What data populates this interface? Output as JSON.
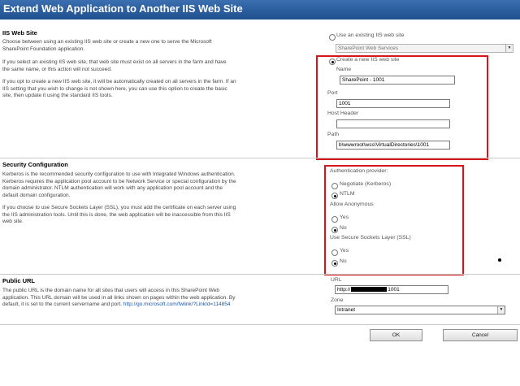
{
  "window": {
    "title": "Extend Web Application to Another IIS Web Site"
  },
  "iis_section": {
    "title": "IIS Web Site",
    "desc1": "Choose between using an existing IIS web site or create a new one to serve the Microsoft SharePoint Foundation application.",
    "desc2": "If you select an existing IIS web site, that web site must exist on all servers in the farm and have the same name, or this action will not succeed.",
    "desc3": "If you opt to create a new IIS web site, it will be automatically created on all servers in the farm. If an IIS setting that you wish to change is not shown here, you can use this option to create the basic site, then update it using the standard IIS tools.",
    "use_existing_label": "Use an existing IIS web site",
    "existing_select_value": "SharePoint Web Services",
    "create_new_label": "Create a new IIS web site",
    "name_label": "Name",
    "name_value": "SharePoint - 1001",
    "port_label": "Port",
    "port_value": "1001",
    "host_header_label": "Host Header",
    "host_header_value": "",
    "path_label": "Path",
    "path_value": "b\\wwwroot\\wss\\VirtualDirectories\\1001"
  },
  "security_section": {
    "title": "Security Configuration",
    "desc1": "Kerberos is the recommended security configuration to use with Integrated Windows authentication. Kerberos requires the application pool account to be Network Service or special configuration by the domain administrator. NTLM authentication will work with any application pool account and the default domain configuration.",
    "desc2": "If you choose to use Secure Sockets Layer (SSL), you must add the certificate on each server using the IIS administration tools. Until this is done, the web application will be inaccessible from this IIS web site.",
    "auth_provider_label": "Authentication provider:",
    "negotiate_label": "Negotiate (Kerberos)",
    "ntlm_label": "NTLM",
    "anon_label": "Allow Anonymous",
    "anon_yes": "Yes",
    "anon_no": "No",
    "ssl_label": "Use Secure Sockets Layer (SSL)",
    "ssl_yes": "Yes",
    "ssl_no": "No"
  },
  "url_section": {
    "title": "Public URL",
    "desc": "The public URL is the domain name for all sites that users will access in this SharePoint Web application. This URL domain will be used in all links shown on pages within the web application. By default, it is set to the current servername and port.",
    "link_text": "http://go.microsoft.com/fwlink/?LinkId=114854",
    "url_label": "URL",
    "url_prefix": "http://",
    "url_suffix": "1001",
    "zone_label": "Zone",
    "zone_value": "Intranet"
  },
  "buttons": {
    "ok": "OK",
    "cancel": "Cancel"
  }
}
